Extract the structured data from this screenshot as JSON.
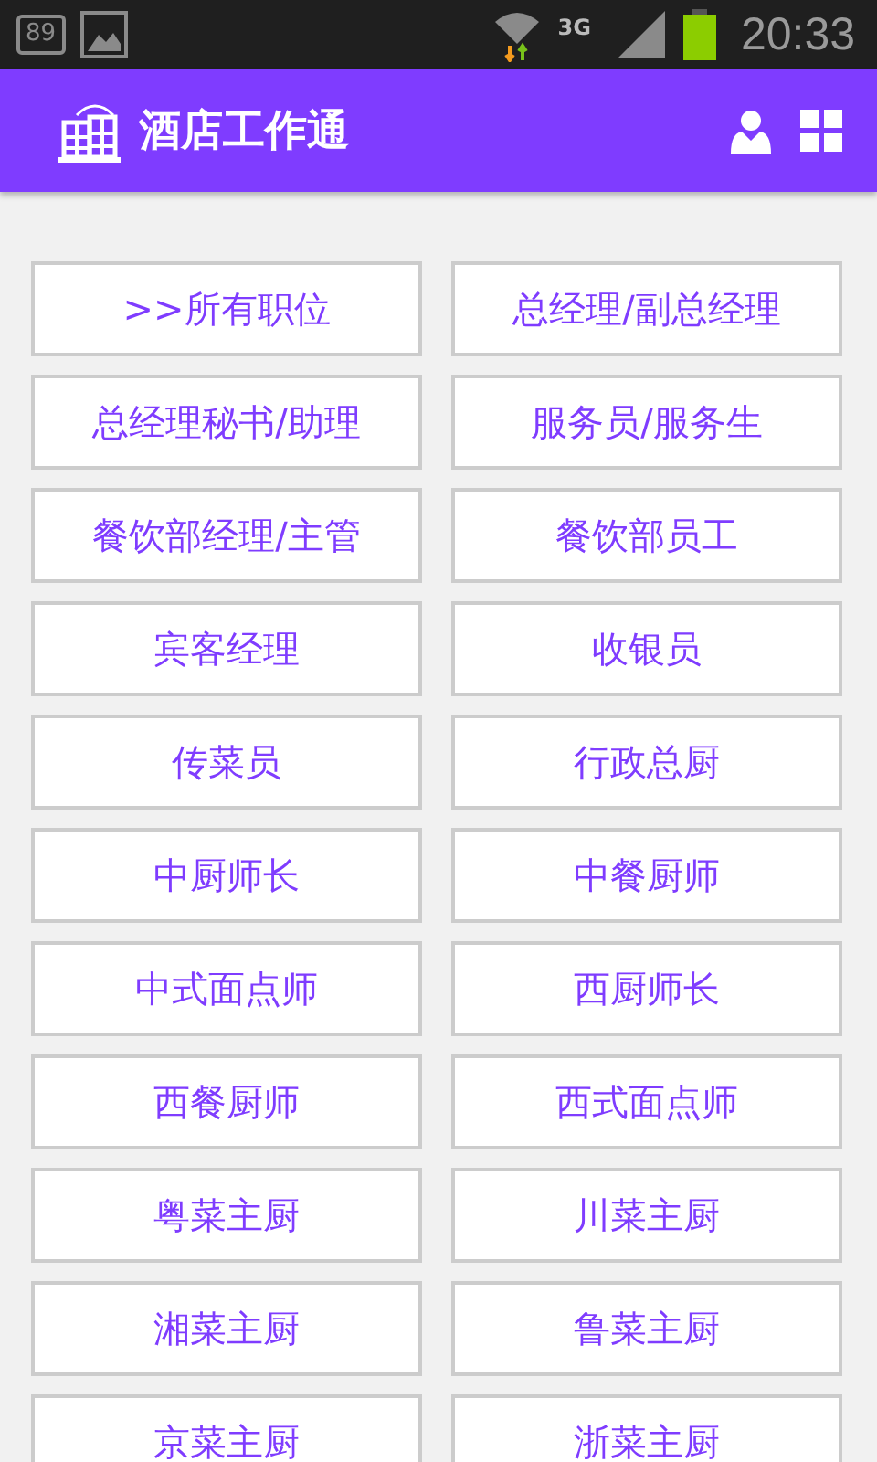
{
  "status_bar": {
    "notification_count": "89",
    "network": "3G",
    "time": "20:33"
  },
  "app_bar": {
    "title": "酒店工作通"
  },
  "positions": [
    {
      "label": ">>所有职位"
    },
    {
      "label": "总经理/副总经理"
    },
    {
      "label": "总经理秘书/助理"
    },
    {
      "label": "服务员/服务生"
    },
    {
      "label": "餐饮部经理/主管"
    },
    {
      "label": "餐饮部员工"
    },
    {
      "label": "宾客经理"
    },
    {
      "label": "收银员"
    },
    {
      "label": "传菜员"
    },
    {
      "label": "行政总厨"
    },
    {
      "label": "中厨师长"
    },
    {
      "label": "中餐厨师"
    },
    {
      "label": "中式面点师"
    },
    {
      "label": "西厨师长"
    },
    {
      "label": "西餐厨师"
    },
    {
      "label": "西式面点师"
    },
    {
      "label": "粤菜主厨"
    },
    {
      "label": "川菜主厨"
    },
    {
      "label": "湘菜主厨"
    },
    {
      "label": "鲁菜主厨"
    },
    {
      "label": "京菜主厨"
    },
    {
      "label": "浙菜主厨"
    }
  ]
}
